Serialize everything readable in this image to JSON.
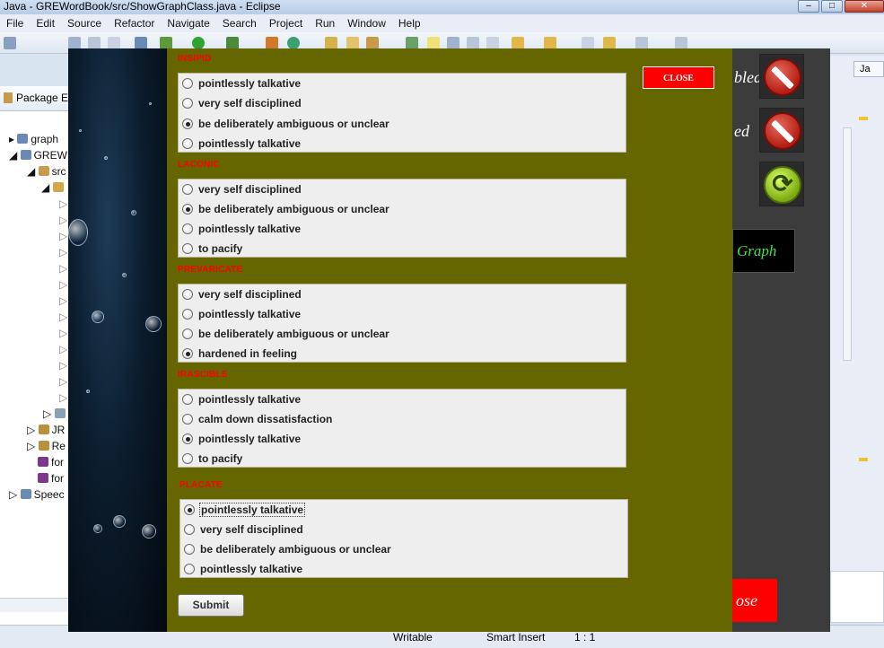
{
  "window": {
    "title": "Java - GREWordBook/src/ShowGraphClass.java - Eclipse",
    "controls": [
      "–",
      "□",
      "✕"
    ]
  },
  "menu": [
    "File",
    "Edit",
    "Source",
    "Refactor",
    "Navigate",
    "Search",
    "Project",
    "Run",
    "Window",
    "Help"
  ],
  "package_explorer": {
    "title": "Package Ex",
    "items": [
      "graph",
      "GREW",
      "src",
      "JR",
      "Re",
      "for",
      "for",
      "Speec"
    ]
  },
  "perspective_tab": "Ja",
  "status_bar": {
    "writable": "Writable",
    "insert_mode": "Smart Insert",
    "position": "1 : 1"
  },
  "side_panel": {
    "label_1": "bled",
    "label_2": "ed",
    "graph_button": "Graph",
    "close_button": "ose"
  },
  "quiz": {
    "close_label": "CLOSE",
    "submit_label": "Submit",
    "questions": [
      {
        "word": "INSIPID",
        "options": [
          "pointlessly talkative",
          "very self disciplined",
          "be deliberately ambiguous or unclear",
          "pointlessly talkative"
        ],
        "selected": 2
      },
      {
        "word": "LACONIC",
        "options": [
          "very self disciplined",
          "be deliberately ambiguous or unclear",
          "pointlessly talkative",
          "to pacify"
        ],
        "selected": 1
      },
      {
        "word": "PREVARICATE",
        "options": [
          "very self disciplined",
          "pointlessly talkative",
          "be deliberately ambiguous or unclear",
          "hardened in feeling"
        ],
        "selected": 3
      },
      {
        "word": "IRASCIBLE",
        "options": [
          "pointlessly talkative",
          "calm down dissatisfaction",
          "pointlessly talkative",
          "to pacify"
        ],
        "selected": 2
      },
      {
        "word": "PLACATE",
        "options": [
          "pointlessly talkative",
          "very self disciplined",
          "be deliberately ambiguous or unclear",
          "pointlessly talkative"
        ],
        "selected": 0
      }
    ]
  }
}
